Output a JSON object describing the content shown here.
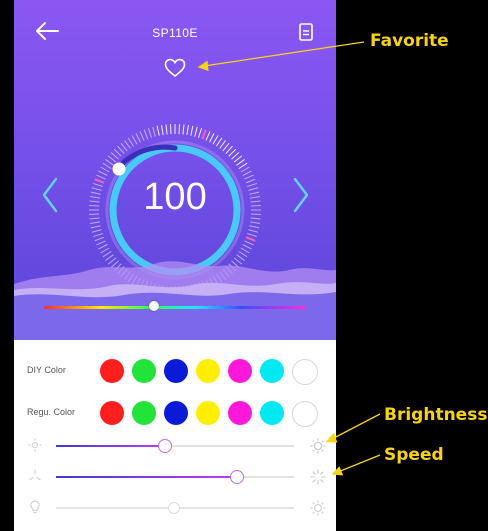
{
  "header": {
    "title": "SP110E"
  },
  "dial": {
    "value": "100"
  },
  "hue_slider": {
    "position": 0.42
  },
  "diy_color": {
    "label": "DIY Color",
    "colors": [
      "#ff1f1f",
      "#21e33a",
      "#0a1bd8",
      "#ffee00",
      "#ff18d9",
      "#00e9f2",
      "#ffffff"
    ]
  },
  "regular_color": {
    "label": "Regu. Color",
    "colors": [
      "#ff1f1f",
      "#21e33a",
      "#0a1bd8",
      "#ffee00",
      "#ff18d9",
      "#00e9f2",
      "#ffffff"
    ]
  },
  "sliders": {
    "brightness_level": 0.46,
    "speed_level": 0.76,
    "third_level": 0.5
  },
  "callouts": {
    "favorite": "Favorite",
    "brightness": "Brightness",
    "speed": "Speed"
  },
  "colors": {
    "accent": "#c76bf2",
    "dial_ring": "#49c9f5",
    "callout": "#f7d316"
  }
}
